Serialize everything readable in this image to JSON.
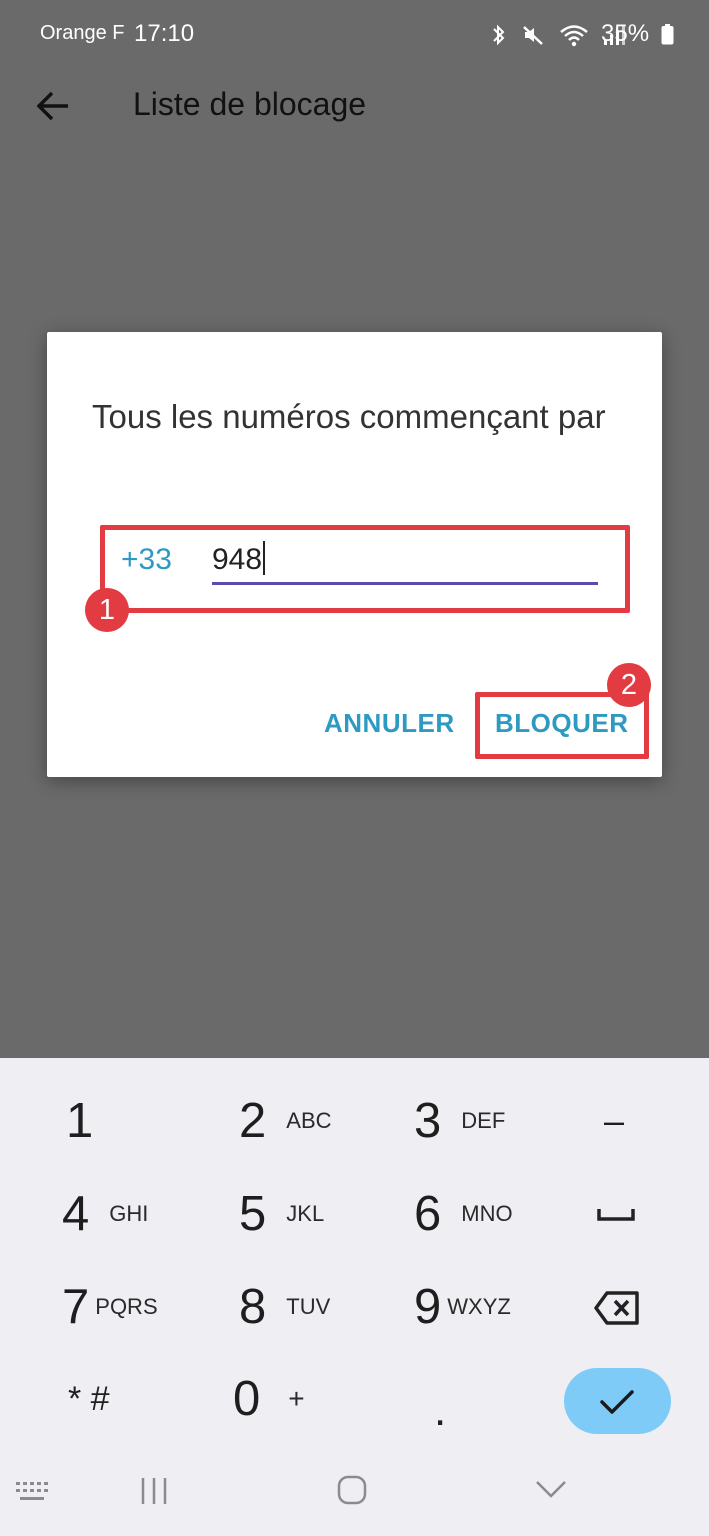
{
  "status_bar": {
    "carrier": "Orange F",
    "time": "17:10",
    "battery": "35%",
    "icons": [
      "bluetooth-icon",
      "mute-icon",
      "wifi-icon",
      "signal-icon",
      "battery-icon"
    ]
  },
  "header": {
    "back_icon": "arrow-left-icon",
    "title": "Liste de blocage"
  },
  "dialog": {
    "title": "Tous les numéros commençant par",
    "prefix": "+33",
    "number_value": "948",
    "cancel_label": "ANNULER",
    "block_label": "BLOQUER",
    "marker_1": "1",
    "marker_2": "2"
  },
  "keyboard": {
    "keys": [
      {
        "digit": "1",
        "letters": ""
      },
      {
        "digit": "2",
        "letters": "ABC"
      },
      {
        "digit": "3",
        "letters": "DEF"
      },
      {
        "digit": "4",
        "letters": "GHI"
      },
      {
        "digit": "5",
        "letters": "JKL"
      },
      {
        "digit": "6",
        "letters": "MNO"
      },
      {
        "digit": "7",
        "letters": "PQRS"
      },
      {
        "digit": "8",
        "letters": "TUV"
      },
      {
        "digit": "9",
        "letters": "WXYZ"
      },
      {
        "digit": "0",
        "letters": "+"
      }
    ],
    "star_hash": "* #",
    "dot": ".",
    "minus": "–",
    "function_icons": [
      "space-icon",
      "backspace-icon",
      "checkmark-icon",
      "keyboard-grid-icon"
    ]
  },
  "nav_bar": {
    "icons": [
      "recents-icon",
      "home-icon",
      "back-chevron-icon"
    ]
  },
  "colors": {
    "accent": "#2d9ac1",
    "annotation_red": "#e23b41",
    "underline": "#5b4bb0",
    "done_key": "#7ecbf7",
    "overlay": "#6a6a6a"
  }
}
